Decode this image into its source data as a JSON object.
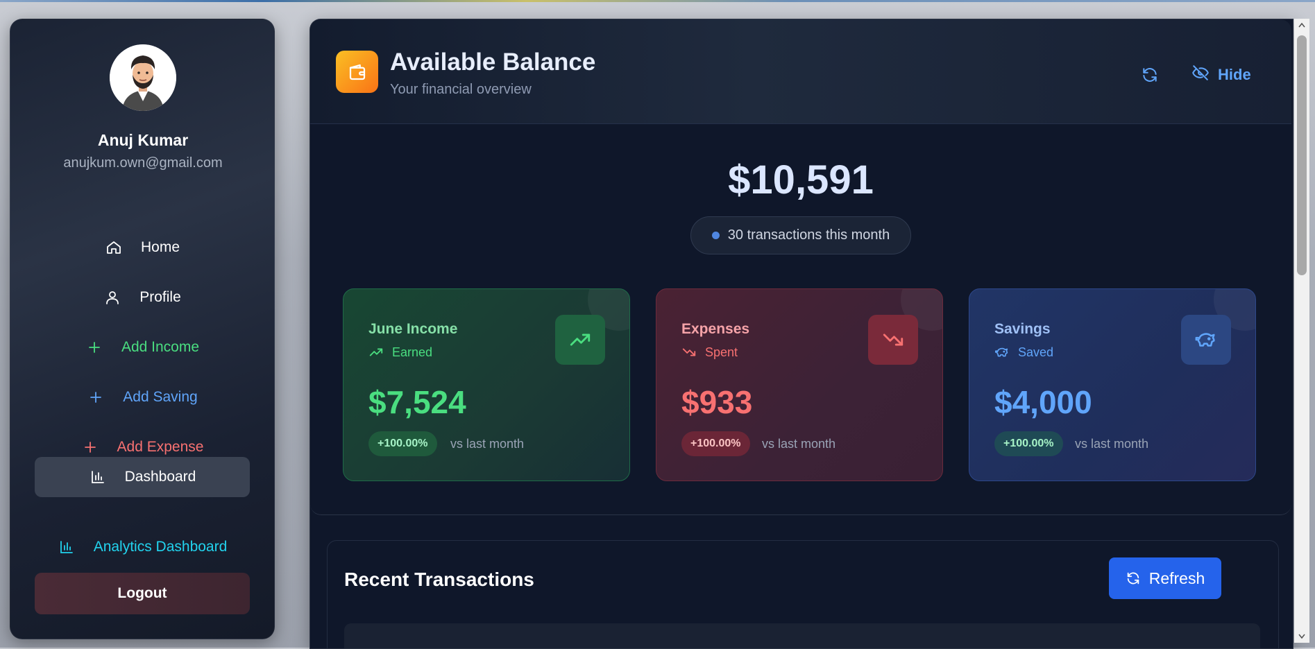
{
  "user": {
    "name": "Anuj Kumar",
    "email": "anujkum.own@gmail.com"
  },
  "nav": {
    "home": "Home",
    "profile": "Profile",
    "add_income": "Add Income",
    "add_saving": "Add Saving",
    "add_expense": "Add Expense",
    "dashboard": "Dashboard",
    "analytics": "Analytics Dashboard",
    "logout": "Logout"
  },
  "header": {
    "title": "Available Balance",
    "subtitle": "Your financial overview",
    "hide_label": "Hide"
  },
  "balance": {
    "amount": "$10,591",
    "transactions": "30 transactions this month"
  },
  "stats": {
    "income": {
      "title": "June Income",
      "sub": "Earned",
      "amount": "$7,524",
      "change": "+100.00%",
      "vs": "vs last month",
      "color": "#4ade80"
    },
    "expense": {
      "title": "Expenses",
      "sub": "Spent",
      "amount": "$933",
      "change": "+100.00%",
      "vs": "vs last month",
      "color": "#f87171"
    },
    "saving": {
      "title": "Savings",
      "sub": "Saved",
      "amount": "$4,000",
      "change": "+100.00%",
      "vs": "vs last month",
      "color": "#60a5fa"
    }
  },
  "recent": {
    "title": "Recent Transactions",
    "refresh_label": "Refresh"
  },
  "colors": {
    "accent_blue": "#2563eb",
    "wallet_orange": "#f59e0b",
    "panel_bg": "#0f172a"
  }
}
